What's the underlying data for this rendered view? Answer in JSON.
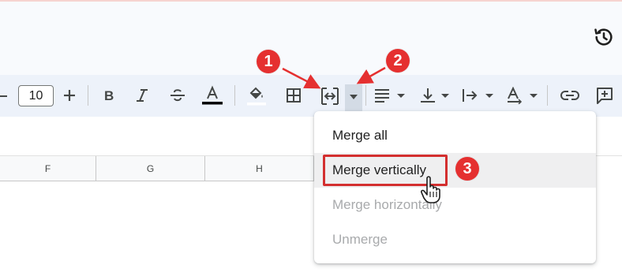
{
  "toolbar": {
    "font_size": "10",
    "history_icon": "history-icon",
    "icons": [
      "minus-icon",
      "plus-icon",
      "bold-icon",
      "italic-icon",
      "strikethrough-icon",
      "text-color-icon",
      "fill-color-icon",
      "borders-icon",
      "merge-cells-icon",
      "merge-dropdown-caret-icon",
      "align-icon",
      "vertical-align-icon",
      "text-direction-icon",
      "text-rotation-icon",
      "link-icon",
      "comment-icon"
    ]
  },
  "columns": [
    "F",
    "G",
    "H"
  ],
  "menu": {
    "items": [
      {
        "label": "Merge all",
        "state": "enabled"
      },
      {
        "label": "Merge vertically",
        "state": "hover"
      },
      {
        "label": "Merge horizontally",
        "state": "disabled"
      },
      {
        "label": "Unmerge",
        "state": "disabled"
      }
    ]
  },
  "annotations": {
    "badges": [
      "1",
      "2",
      "3"
    ],
    "color": "#e53030"
  },
  "colors": {
    "toolbar_bg": "#edf2fa",
    "header_bg": "#f8fafd",
    "annotation_red": "#d32f2f",
    "text_color_underline": "#000000"
  }
}
